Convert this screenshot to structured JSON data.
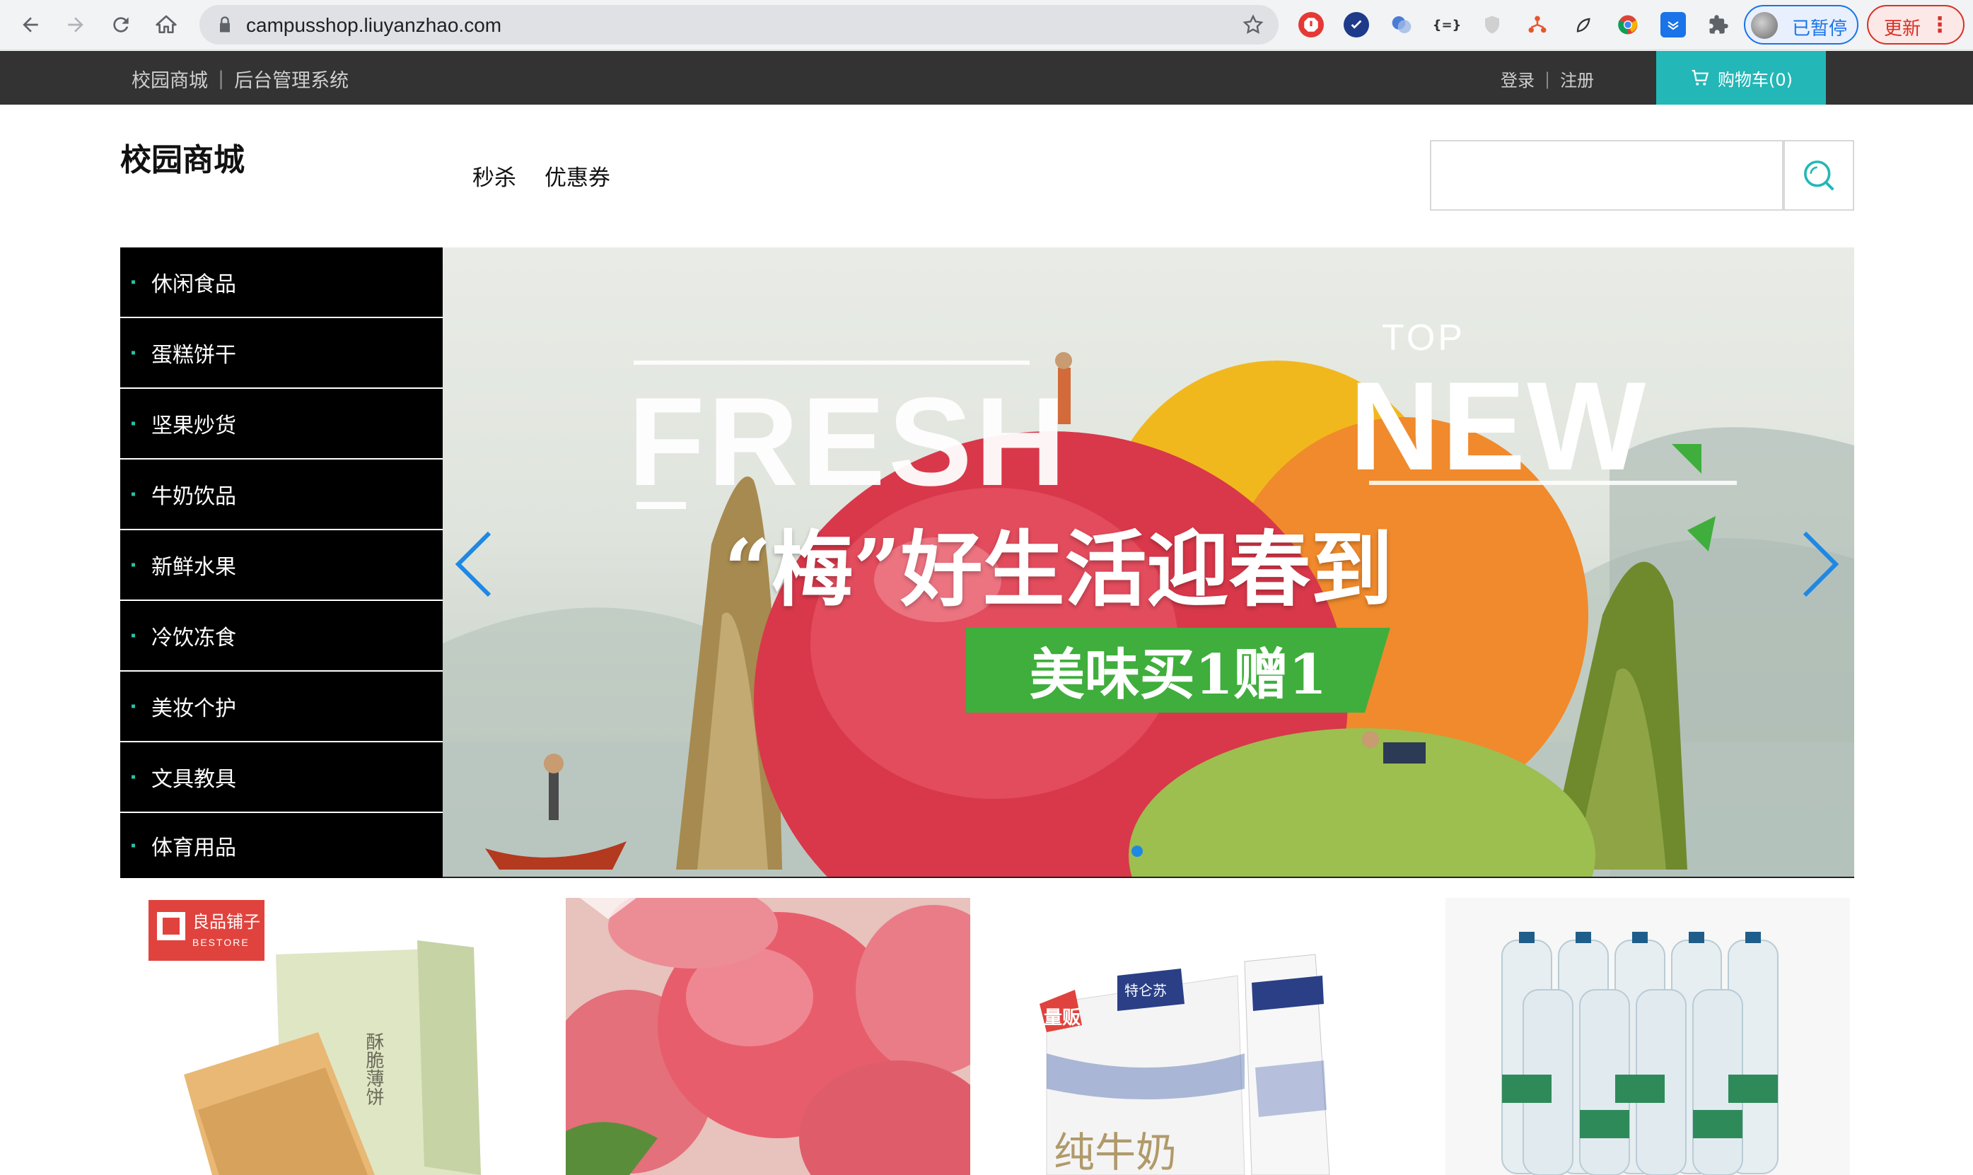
{
  "browser": {
    "url": "campusshop.liuyanzhao.com",
    "profile_label": "已暂停",
    "update_label": "更新",
    "extensions": [
      "adblock-icon",
      "verified-icon",
      "translate-icon",
      "json-icon",
      "shield-icon",
      "network-icon",
      "leaf-icon",
      "chrome-icon",
      "inbox-icon",
      "puzzle-icon"
    ]
  },
  "topbar": {
    "site_name": "校园商城",
    "admin_link": "后台管理系统",
    "login": "登录",
    "register": "注册",
    "cart_label": "购物车(0)"
  },
  "header": {
    "logo": "校园商城",
    "nav": [
      "秒杀",
      "优惠券"
    ],
    "search_value": ""
  },
  "categories": [
    "休闲食品",
    "蛋糕饼干",
    "坚果炒货",
    "牛奶饮品",
    "新鲜水果",
    "冷饮冻食",
    "美妆个护",
    "文具教具",
    "体育用品"
  ],
  "banner": {
    "fresh": "FRESH",
    "top": "TOP",
    "new": "NEW",
    "headline": "“梅”好生活迎春到",
    "promo": "美味买1赠1"
  },
  "products": [
    {
      "name": "biscuit-box",
      "brand": "良品铺子",
      "brand_en": "BESTORE",
      "box_text": "酥脆薄饼"
    },
    {
      "name": "apples"
    },
    {
      "name": "milk-box",
      "tag": "量贩",
      "brand": "特仑苏",
      "text": "纯牛奶"
    },
    {
      "name": "water-bottles"
    }
  ],
  "colors": {
    "topbar": "#333333",
    "cart": "#23b7b7",
    "sidebar": "#000000",
    "promo_green": "#3fae3c",
    "arrow_blue": "#1e88e5"
  }
}
